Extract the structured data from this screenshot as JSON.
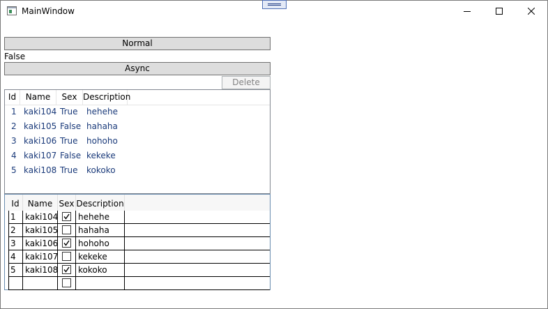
{
  "window": {
    "title": "MainWindow",
    "icons": {
      "app": "window-app-icon",
      "minimize": "minimize-icon",
      "maximize": "maximize-icon",
      "close": "close-icon"
    }
  },
  "buttons": {
    "normal_label": "Normal",
    "async_label": "Async",
    "delete_label": "Delete"
  },
  "status_text": "False",
  "listview": {
    "columns": [
      "Id",
      "Name",
      "Sex",
      "Description"
    ],
    "rows": [
      {
        "id": "1",
        "name": "kaki104",
        "sex": "True",
        "description": "hehehe"
      },
      {
        "id": "2",
        "name": "kaki105",
        "sex": "False",
        "description": "hahaha"
      },
      {
        "id": "3",
        "name": "kaki106",
        "sex": "True",
        "description": "hohoho"
      },
      {
        "id": "4",
        "name": "kaki107",
        "sex": "False",
        "description": "kekeke"
      },
      {
        "id": "5",
        "name": "kaki108",
        "sex": "True",
        "description": "kokoko"
      }
    ]
  },
  "datagrid": {
    "columns": [
      "Id",
      "Name",
      "Sex",
      "Description"
    ],
    "rows": [
      {
        "id": "1",
        "name": "kaki104",
        "sex": true,
        "description": "hehehe"
      },
      {
        "id": "2",
        "name": "kaki105",
        "sex": false,
        "description": "hahaha"
      },
      {
        "id": "3",
        "name": "kaki106",
        "sex": true,
        "description": "hohoho"
      },
      {
        "id": "4",
        "name": "kaki107",
        "sex": false,
        "description": "kekeke"
      },
      {
        "id": "5",
        "name": "kaki108",
        "sex": true,
        "description": "kokoko"
      },
      {
        "id": "",
        "name": "",
        "sex": false,
        "description": ""
      }
    ]
  }
}
